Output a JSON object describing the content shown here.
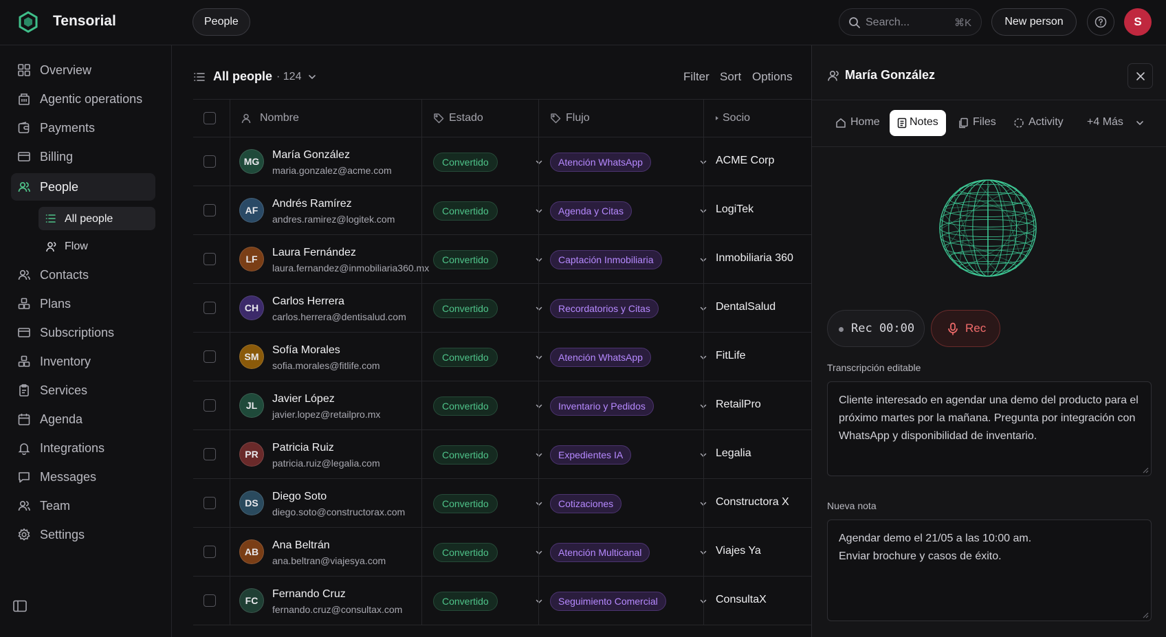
{
  "app": {
    "name": "Tensorial",
    "accent": "#4fc48a",
    "danger": "#c0283f"
  },
  "topbar": {
    "breadcrumb": "People",
    "search_placeholder": "Search...",
    "search_shortcut": "⌘K",
    "new_button": "New person",
    "avatar_initial": "S"
  },
  "sidebar": {
    "items": [
      {
        "label": "Overview",
        "icon": "grid-icon"
      },
      {
        "label": "Agentic operations",
        "icon": "building-icon"
      },
      {
        "label": "Payments",
        "icon": "wallet-icon"
      },
      {
        "label": "Billing",
        "icon": "credit-card-icon"
      },
      {
        "label": "People",
        "icon": "users-icon",
        "active": true
      },
      {
        "label": "Contacts",
        "icon": "contacts-icon"
      },
      {
        "label": "Plans",
        "icon": "layers-icon"
      },
      {
        "label": "Subscriptions",
        "icon": "card-icon"
      },
      {
        "label": "Inventory",
        "icon": "boxes-icon"
      },
      {
        "label": "Services",
        "icon": "clipboard-icon"
      },
      {
        "label": "Agenda",
        "icon": "calendar-icon"
      },
      {
        "label": "Integrations",
        "icon": "bell-icon"
      },
      {
        "label": "Messages",
        "icon": "message-icon"
      },
      {
        "label": "Team",
        "icon": "team-icon"
      },
      {
        "label": "Settings",
        "icon": "gear-icon"
      }
    ],
    "subitems": [
      {
        "label": "All people",
        "active": true
      },
      {
        "label": "Flow"
      }
    ]
  },
  "list": {
    "title": "All people",
    "count": "· 124",
    "actions": [
      "Filter",
      "Sort",
      "Options"
    ],
    "columns": {
      "nombre": "Nombre",
      "estado": "Estado",
      "flujo": "Flujo",
      "socio": "Socio"
    },
    "rows": [
      {
        "initials": "MG",
        "name": "María González",
        "email": "maria.gonzalez@acme.com",
        "estado": "Convertido",
        "flujo": "Atención WhatsApp",
        "socio": "ACME Corp",
        "color": "#1f4a3a"
      },
      {
        "initials": "AF",
        "name": "Andrés Ramírez",
        "email": "andres.ramirez@logitek.com",
        "estado": "Convertido",
        "flujo": "Agenda y Citas",
        "socio": "LogiTek",
        "color": "#2a4a66"
      },
      {
        "initials": "LF",
        "name": "Laura Fernández",
        "email": "laura.fernandez@inmobiliaria360.mx",
        "estado": "Convertido",
        "flujo": "Captación Inmobiliaria",
        "socio": "Inmobiliaria 360",
        "color": "#7a3e16"
      },
      {
        "initials": "CH",
        "name": "Carlos Herrera",
        "email": "carlos.herrera@dentisalud.com",
        "estado": "Convertido",
        "flujo": "Recordatorios y Citas",
        "socio": "DentalSalud",
        "color": "#3c2a6a"
      },
      {
        "initials": "SM",
        "name": "Sofía Morales",
        "email": "sofia.morales@fitlife.com",
        "estado": "Convertido",
        "flujo": "Atención WhatsApp",
        "socio": "FitLife",
        "color": "#8a5a0a"
      },
      {
        "initials": "JL",
        "name": "Javier López",
        "email": "javier.lopez@retailpro.mx",
        "estado": "Convertido",
        "flujo": "Inventario y Pedidos",
        "socio": "RetailPro",
        "color": "#1f4a3a"
      },
      {
        "initials": "PR",
        "name": "Patricia Ruiz",
        "email": "patricia.ruiz@legalia.com",
        "estado": "Convertido",
        "flujo": "Expedientes IA",
        "socio": "Legalia",
        "color": "#6a2a2a"
      },
      {
        "initials": "DS",
        "name": "Diego Soto",
        "email": "diego.soto@constructorax.com",
        "estado": "Convertido",
        "flujo": "Cotizaciones",
        "socio": "Constructora X",
        "color": "#2a4a5e"
      },
      {
        "initials": "AB",
        "name": "Ana Beltrán",
        "email": "ana.beltran@viajesya.com",
        "estado": "Convertido",
        "flujo": "Atención Multicanal",
        "socio": "Viajes Ya",
        "color": "#7a3e16"
      },
      {
        "initials": "FC",
        "name": "Fernando Cruz",
        "email": "fernando.cruz@consultax.com",
        "estado": "Convertido",
        "flujo": "Seguimiento Comercial",
        "socio": "ConsultaX",
        "color": "#1f3f34"
      }
    ]
  },
  "panel": {
    "title": "María González",
    "tabs": [
      {
        "label": "Home",
        "icon": "home-icon"
      },
      {
        "label": "Notes",
        "icon": "note-icon",
        "active": true
      },
      {
        "label": "Files",
        "icon": "files-icon"
      },
      {
        "label": "Activity",
        "icon": "activity-icon"
      },
      {
        "label": "+4 Más",
        "icon": ""
      }
    ],
    "rec_time": "Rec 00:00",
    "rec_button": "Rec",
    "transcript_label": "Transcripción editable",
    "transcript": "Cliente interesado en agendar una demo del producto para el próximo martes por la mañana. Pregunta por integración con WhatsApp y disponibilidad de inventario.",
    "note_label": "Nueva nota",
    "note_line1": "Agendar demo el 21/05 a las 10:00 am.",
    "note_line2": "Enviar brochure y casos de éxito."
  }
}
